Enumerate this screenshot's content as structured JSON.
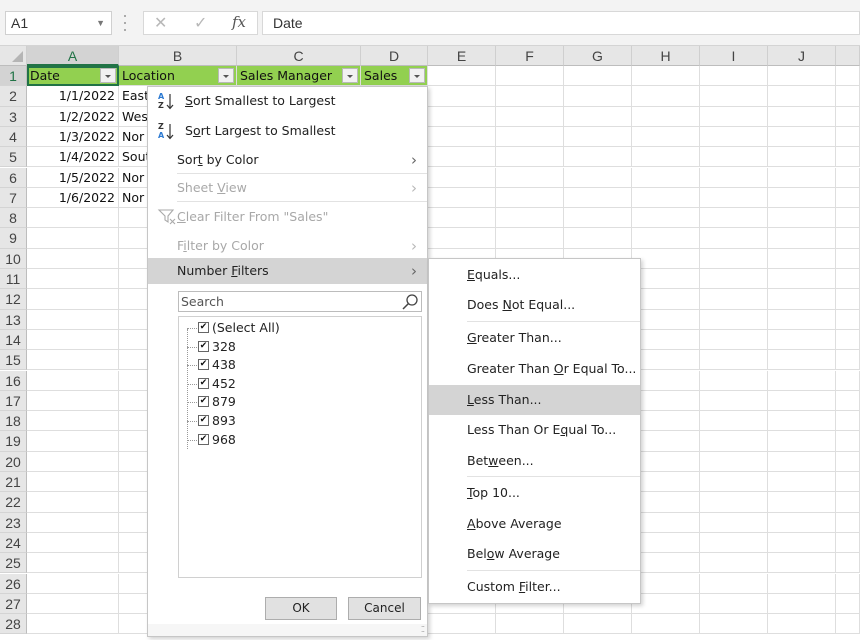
{
  "formula_bar": {
    "name_box": "A1",
    "cancel_icon": "close-icon",
    "enter_icon": "check-icon",
    "fx_label": "fx",
    "formula_value": "Date"
  },
  "grid": {
    "columns": [
      "A",
      "B",
      "C",
      "D",
      "E",
      "F",
      "G",
      "H",
      "I",
      "J"
    ],
    "rows": [
      "1",
      "2",
      "3",
      "4",
      "5",
      "6",
      "7",
      "8",
      "9",
      "10",
      "11",
      "12",
      "13",
      "14",
      "15",
      "16",
      "17",
      "18",
      "19",
      "20",
      "21",
      "22",
      "23",
      "24",
      "25",
      "26",
      "27",
      "28"
    ],
    "header_color": "#92D050",
    "headers": [
      "Date",
      "Location",
      "Sales Manager",
      "Sales"
    ],
    "data": [
      [
        "1/1/2022",
        "East"
      ],
      [
        "1/2/2022",
        "Wes"
      ],
      [
        "1/3/2022",
        "Nor"
      ],
      [
        "1/4/2022",
        "Sout"
      ],
      [
        "1/5/2022",
        "Nor"
      ],
      [
        "1/6/2022",
        "Nor"
      ]
    ]
  },
  "filter_menu": {
    "sort_asc": {
      "pre": "",
      "u": "S",
      "post": "ort Smallest to Largest"
    },
    "sort_desc": {
      "pre": "S",
      "u": "o",
      "post": "rt Largest to Smallest"
    },
    "sort_color": {
      "pre": "Sor",
      "u": "t",
      "post": " by Color"
    },
    "sheet_view": {
      "pre": "Sheet ",
      "u": "V",
      "post": "iew"
    },
    "clear_filter": {
      "pre": "",
      "u": "C",
      "post": "lear Filter From \"Sales\""
    },
    "filter_color": {
      "pre": "F",
      "u": "i",
      "post": "lter by Color"
    },
    "number_filters": {
      "pre": "Number ",
      "u": "F",
      "post": "ilters"
    },
    "search_placeholder": "Search",
    "items": [
      {
        "label": "(Select All)",
        "checked": "✔"
      },
      {
        "label": "328",
        "checked": "✔"
      },
      {
        "label": "438",
        "checked": "✔"
      },
      {
        "label": "452",
        "checked": "✔"
      },
      {
        "label": "879",
        "checked": "✔"
      },
      {
        "label": "893",
        "checked": "✔"
      },
      {
        "label": "968",
        "checked": "✔"
      }
    ],
    "ok_label": "OK",
    "cancel_label": "Cancel"
  },
  "number_filters_submenu": [
    {
      "pre": "",
      "u": "E",
      "post": "quals..."
    },
    {
      "pre": "Does ",
      "u": "N",
      "post": "ot Equal..."
    },
    {
      "pre": "",
      "u": "G",
      "post": "reater Than..."
    },
    {
      "pre": "Greater Than ",
      "u": "O",
      "post": "r Equal To..."
    },
    {
      "pre": "",
      "u": "L",
      "post": "ess Than..."
    },
    {
      "pre": "Less Than Or E",
      "u": "q",
      "post": "ual To..."
    },
    {
      "pre": "Bet",
      "u": "w",
      "post": "een..."
    },
    {
      "pre": "",
      "u": "T",
      "post": "op 10..."
    },
    {
      "pre": "",
      "u": "A",
      "post": "bove Average"
    },
    {
      "pre": "Bel",
      "u": "o",
      "post": "w Average"
    },
    {
      "pre": "Custom ",
      "u": "F",
      "post": "ilter..."
    }
  ]
}
